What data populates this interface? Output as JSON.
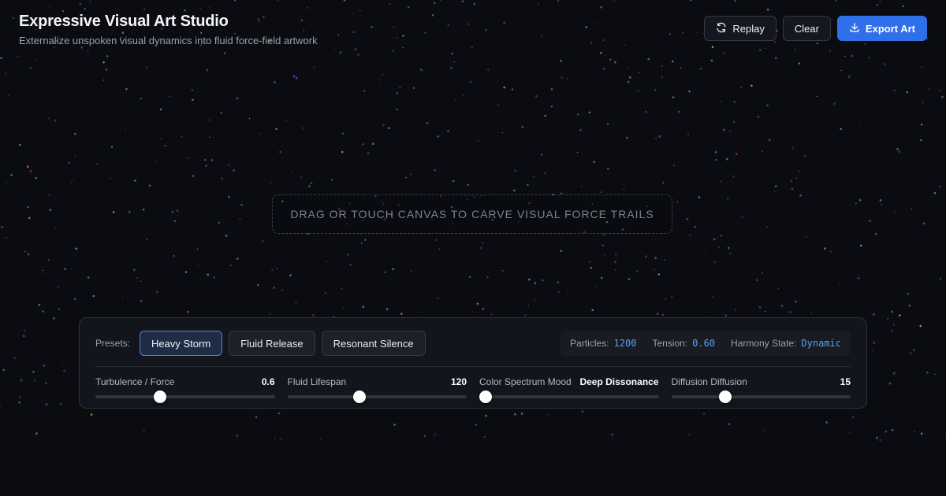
{
  "app": {
    "title": "Expressive Visual Art Studio",
    "subtitle": "Externalize unspoken visual dynamics into fluid force-field artwork"
  },
  "toolbar": {
    "replay_label": "Replay",
    "replay_icon": "refresh-icon",
    "clear_label": "Clear",
    "export_label": "Export Art",
    "export_icon": "download-icon",
    "accent_color": "#2f6fea"
  },
  "canvas": {
    "hint": "DRAG OR TOUCH CANVAS TO CARVE VISUAL FORCE TRAILS",
    "background_color": "#0a0c11",
    "particle_colors": [
      "#3fa9d6",
      "#c9a13b",
      "#c0344a",
      "#6a4fc8",
      "#3aa27a",
      "#e0e0e0"
    ]
  },
  "presets": {
    "label": "Presets:",
    "items": [
      {
        "label": "Heavy Storm",
        "active": true
      },
      {
        "label": "Fluid Release",
        "active": false
      },
      {
        "label": "Resonant Silence",
        "active": false
      }
    ]
  },
  "stats": {
    "particles_label": "Particles:",
    "particles_value": "1200",
    "tension_label": "Tension:",
    "tension_value": "0.60",
    "harmony_label": "Harmony State:",
    "harmony_value": "Dynamic"
  },
  "sliders": [
    {
      "label": "Turbulence / Force",
      "value": "0.6",
      "fill": 0.36
    },
    {
      "label": "Fluid Lifespan",
      "value": "120",
      "fill": 0.4
    },
    {
      "label": "Color Spectrum Mood",
      "value": "Deep Dissonance",
      "fill": 0.0
    },
    {
      "label": "Diffusion Diffusion",
      "value": "15",
      "fill": 0.3
    }
  ]
}
